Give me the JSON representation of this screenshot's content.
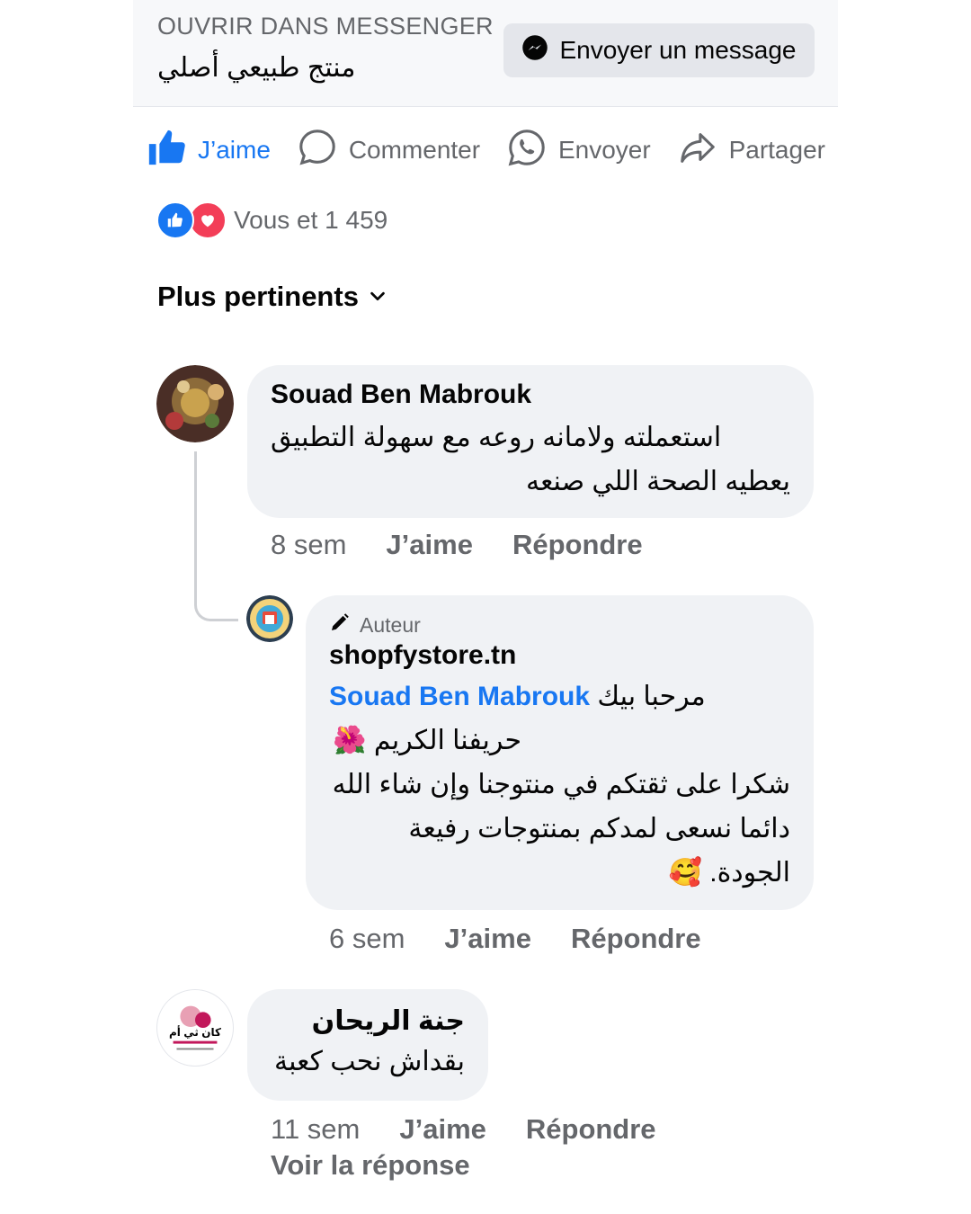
{
  "banner": {
    "label": "OUVRIR DANS MESSENGER",
    "product": "منتج طبيعي أصلي",
    "send_button": "Envoyer un message"
  },
  "actions": {
    "like": "J’aime",
    "comment": "Commenter",
    "send": "Envoyer",
    "share": "Partager"
  },
  "reactions": {
    "summary": "Vous et 1 459"
  },
  "sort": {
    "label": "Plus pertinents"
  },
  "comments": [
    {
      "author": "Souad Ben Mabrouk",
      "lines": [
        "استعملته ولامانه روعه مع سهولة التطبيق",
        "يعطيه الصحة  اللي صنعه"
      ],
      "time": "8 sem",
      "like": "J’aime",
      "reply": "Répondre",
      "replies": [
        {
          "badge": "Auteur",
          "author": "shopfystore.tn",
          "mention": "Souad Ben Mabrouk",
          "line1_suffix": "مرحبا بيك",
          "line2": "حريفنا الكريم 🌺",
          "line3": "شكرا على ثقتكم في منتوجنا وإن شاء الله",
          "line4": "دائما نسعى لمدكم بمنتوجات رفيعة",
          "line5": "الجودة. 🥰",
          "time": "6 sem",
          "like": "J’aime",
          "reply": "Répondre"
        }
      ]
    },
    {
      "author": "جنة الريحان",
      "avatar_text": "كان ثي أم",
      "lines": [
        "بقداش نحب كعبة"
      ],
      "time": "11 sem",
      "like": "J’aime",
      "reply": "Répondre",
      "see_reply": "Voir la réponse"
    }
  ],
  "colors": {
    "accent": "#1877f2",
    "love": "#f33e58",
    "bubble": "#f0f2f5",
    "muted": "#65676b"
  }
}
